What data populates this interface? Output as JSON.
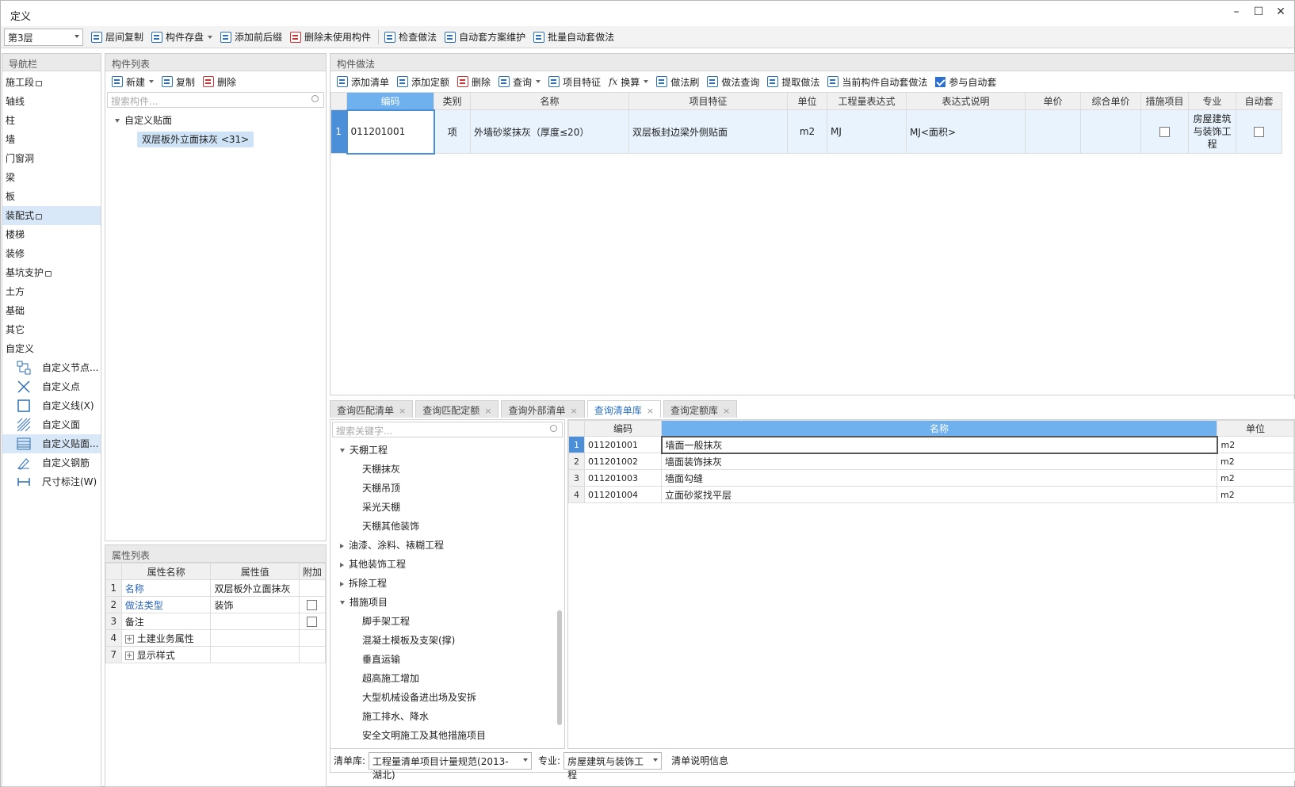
{
  "window": {
    "title": "定义"
  },
  "toolbar": {
    "floor": "第3层",
    "items": [
      "层间复制",
      "构件存盘",
      "添加前后缀",
      "删除未使用构件",
      "检查做法",
      "自动套方案维护",
      "批量自动套做法"
    ]
  },
  "nav": {
    "title": "导航栏",
    "items": [
      "施工段",
      "轴线",
      "柱",
      "墙",
      "门窗洞",
      "梁",
      "板",
      "装配式",
      "楼梯",
      "装修",
      "基坑支护",
      "土方",
      "基础",
      "其它",
      "自定义"
    ],
    "sub_items": [
      "自定义节点...",
      "自定义点",
      "自定义线(X)",
      "自定义面",
      "自定义贴面...",
      "自定义钢筋",
      "尺寸标注(W)"
    ]
  },
  "component_list": {
    "title": "构件列表",
    "new": "新建",
    "copy": "复制",
    "delete": "删除",
    "search_placeholder": "搜索构件...",
    "tree_parent": "自定义贴面",
    "tree_child": "双层板外立面抹灰 <31>"
  },
  "props": {
    "title": "属性列表",
    "headers": [
      "属性名称",
      "属性值",
      "附加"
    ],
    "rows": [
      {
        "n": "1",
        "name": "名称",
        "value": "双层板外立面抹灰"
      },
      {
        "n": "2",
        "name": "做法类型",
        "value": "装饰"
      },
      {
        "n": "3",
        "name": "备注",
        "value": ""
      },
      {
        "n": "4",
        "name": "土建业务属性",
        "value": ""
      },
      {
        "n": "7",
        "name": "显示样式",
        "value": ""
      }
    ]
  },
  "method": {
    "title": "构件做法",
    "toolbar": [
      "添加清单",
      "添加定额",
      "删除",
      "查询",
      "项目特征",
      "换算",
      "做法刷",
      "做法查询",
      "提取做法",
      "当前构件自动套做法",
      "参与自动套"
    ],
    "headers": [
      "编码",
      "类别",
      "名称",
      "项目特征",
      "单位",
      "工程量表达式",
      "表达式说明",
      "单价",
      "综合单价",
      "措施项目",
      "专业",
      "自动套"
    ],
    "row": {
      "n": "1",
      "code": "011201001",
      "type": "项",
      "name": "外墙砂浆抹灰（厚度≤20）",
      "feature": "双层板封边梁外侧贴面",
      "unit": "m2",
      "expr": "MJ",
      "expr_desc": "MJ<面积>",
      "price": "",
      "total": "",
      "specialty": "房屋建筑与装饰工程"
    }
  },
  "bottom": {
    "tabs": [
      "查询匹配清单",
      "查询匹配定额",
      "查询外部清单",
      "查询清单库",
      "查询定额库"
    ],
    "active_tab": 3,
    "search_placeholder": "搜索关键字...",
    "tree": [
      {
        "label": "天棚工程",
        "level": 0,
        "expanded": true
      },
      {
        "label": "天棚抹灰",
        "level": 1
      },
      {
        "label": "天棚吊顶",
        "level": 1
      },
      {
        "label": "采光天棚",
        "level": 1
      },
      {
        "label": "天棚其他装饰",
        "level": 1
      },
      {
        "label": "油漆、涂料、裱糊工程",
        "level": 0,
        "expanded": false
      },
      {
        "label": "其他装饰工程",
        "level": 0,
        "expanded": false
      },
      {
        "label": "拆除工程",
        "level": 0,
        "expanded": false
      },
      {
        "label": "措施项目",
        "level": 0,
        "expanded": true
      },
      {
        "label": "脚手架工程",
        "level": 1
      },
      {
        "label": "混凝土模板及支架(撑)",
        "level": 1
      },
      {
        "label": "垂直运输",
        "level": 1
      },
      {
        "label": "超高施工增加",
        "level": 1
      },
      {
        "label": "大型机械设备进出场及安拆",
        "level": 1
      },
      {
        "label": "施工排水、降水",
        "level": 1
      },
      {
        "label": "安全文明施工及其他措施项目",
        "level": 1
      }
    ],
    "table_headers": [
      "编码",
      "名称",
      "单位"
    ],
    "table_rows": [
      {
        "n": "1",
        "code": "011201001",
        "name": "墙面一般抹灰",
        "unit": "m2"
      },
      {
        "n": "2",
        "code": "011201002",
        "name": "墙面装饰抹灰",
        "unit": "m2"
      },
      {
        "n": "3",
        "code": "011201003",
        "name": "墙面勾缝",
        "unit": "m2"
      },
      {
        "n": "4",
        "code": "011201004",
        "name": "立面砂浆找平层",
        "unit": "m2"
      }
    ],
    "status": {
      "lib_label": "清单库:",
      "lib_value": "工程量清单项目计量规范(2013-湖北)",
      "spec_label": "专业:",
      "spec_value": "房屋建筑与装饰工程",
      "info": "清单说明信息"
    }
  }
}
